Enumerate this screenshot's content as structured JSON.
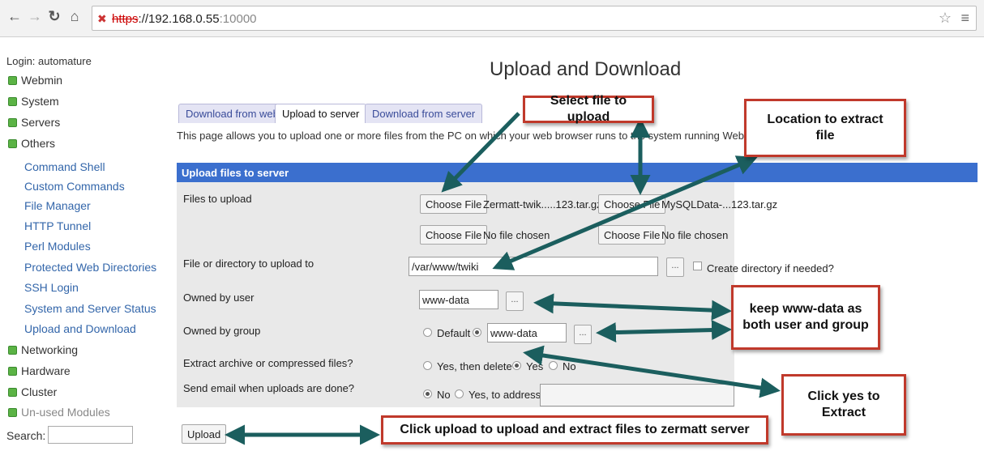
{
  "browser": {
    "url_protocol": "https",
    "url_rest": "://192.168.0.55",
    "url_port": ":10000"
  },
  "sidebar": {
    "login": "Login: automature",
    "categories": [
      "Webmin",
      "System",
      "Servers",
      "Others"
    ],
    "others_items": [
      "Command Shell",
      "Custom Commands",
      "File Manager",
      "HTTP Tunnel",
      "Perl Modules",
      "Protected Web Directories",
      "SSH Login",
      "System and Server Status",
      "Upload and Download"
    ],
    "categories_after": [
      "Networking",
      "Hardware",
      "Cluster",
      "Un-used Modules"
    ],
    "search_label": "Search:"
  },
  "page": {
    "title": "Upload and Download",
    "tabs": [
      "Download from web",
      "Upload to server",
      "Download from server"
    ],
    "active_tab": "Upload to server",
    "intro": "This page allows you to upload one or more files from the PC on which your web browser runs to the system running Webmin."
  },
  "form": {
    "header": "Upload files to server",
    "files_label": "Files to upload",
    "choose_file": "Choose File",
    "file1_name": "Zermatt-twik.....123.tar.gz",
    "file2_name": "MySQLData-...123.tar.gz",
    "no_file": "No file chosen",
    "dest_label": "File or directory to upload to",
    "dest_value": "/var/www/twiki",
    "create_dir": "Create directory if needed?",
    "user_label": "Owned by user",
    "user_value": "www-data",
    "group_label": "Owned by group",
    "group_default": "Default",
    "group_value": "www-data",
    "extract_label": "Extract archive or compressed files?",
    "extract_yes_delete": "Yes, then delete",
    "extract_yes": "Yes",
    "extract_no": "No",
    "email_label": "Send email when uploads are done?",
    "email_no": "No",
    "email_yes": "Yes, to address",
    "browse": "...",
    "upload_button": "Upload"
  },
  "annotations": {
    "select_file": "Select file to upload",
    "location_line1": "Location to extract",
    "location_line2": "file",
    "keep_line1": "keep www-data as",
    "keep_line2": "both user and group",
    "click_yes_line1": "Click yes to",
    "click_yes_line2": "Extract",
    "click_upload": "Click upload to upload and extract files to zermatt server",
    "arrow_color": "#1b5e5e",
    "border_color": "#c0392b"
  }
}
